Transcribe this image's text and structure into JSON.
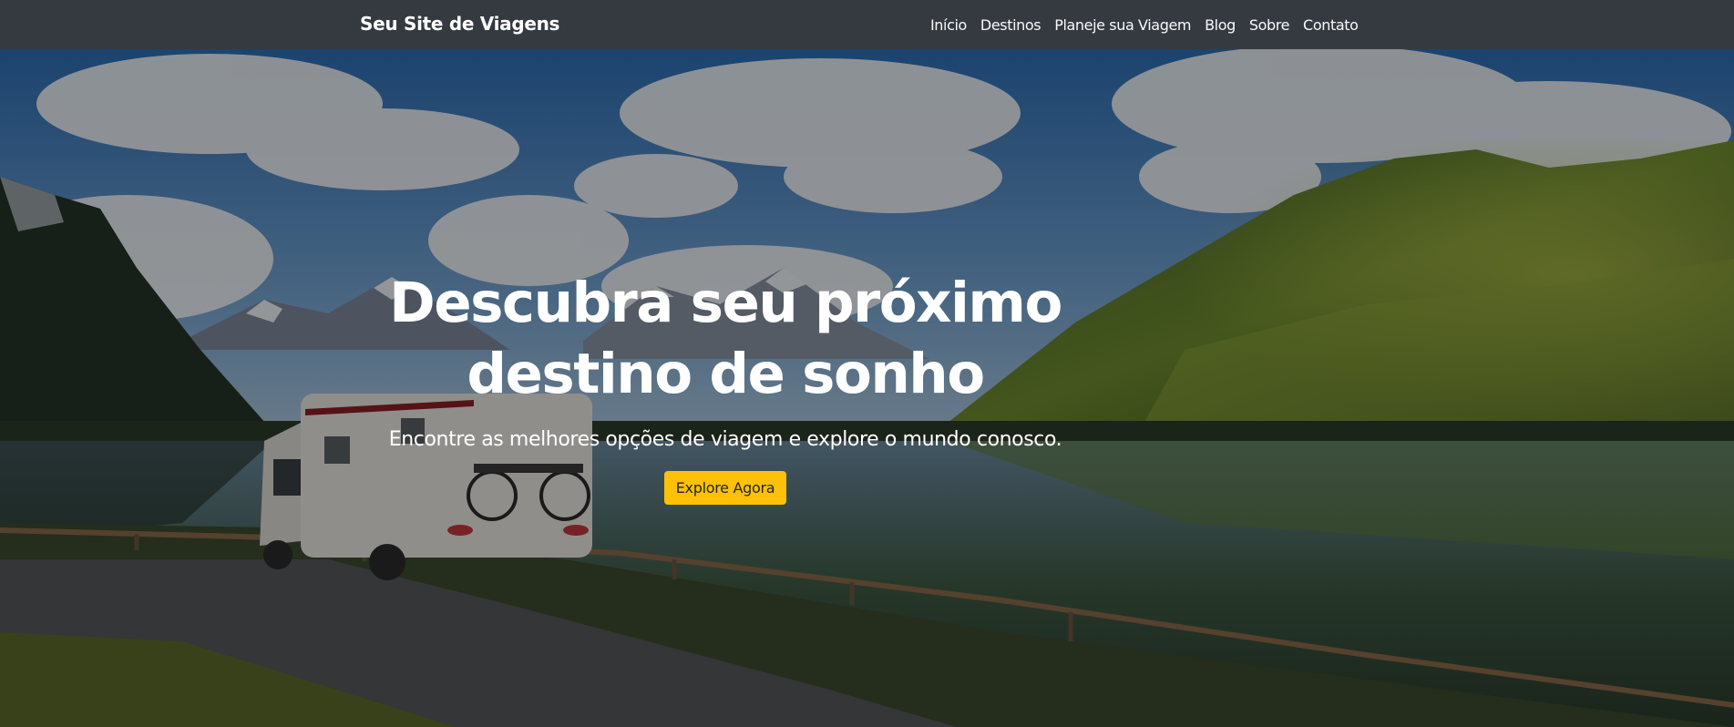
{
  "navbar": {
    "brand": "Seu Site de Viagens",
    "links": [
      "Início",
      "Destinos",
      "Planeje sua Viagem",
      "Blog",
      "Sobre",
      "Contato"
    ]
  },
  "hero": {
    "title": "Descubra seu próximo destino de sonho",
    "subtitle": "Encontre as melhores opções de viagem e explore o mundo conosco.",
    "cta_label": "Explore Agora"
  },
  "colors": {
    "navbar_bg": "#343a40",
    "cta_bg": "#ffc107",
    "text_light": "#ffffff"
  }
}
